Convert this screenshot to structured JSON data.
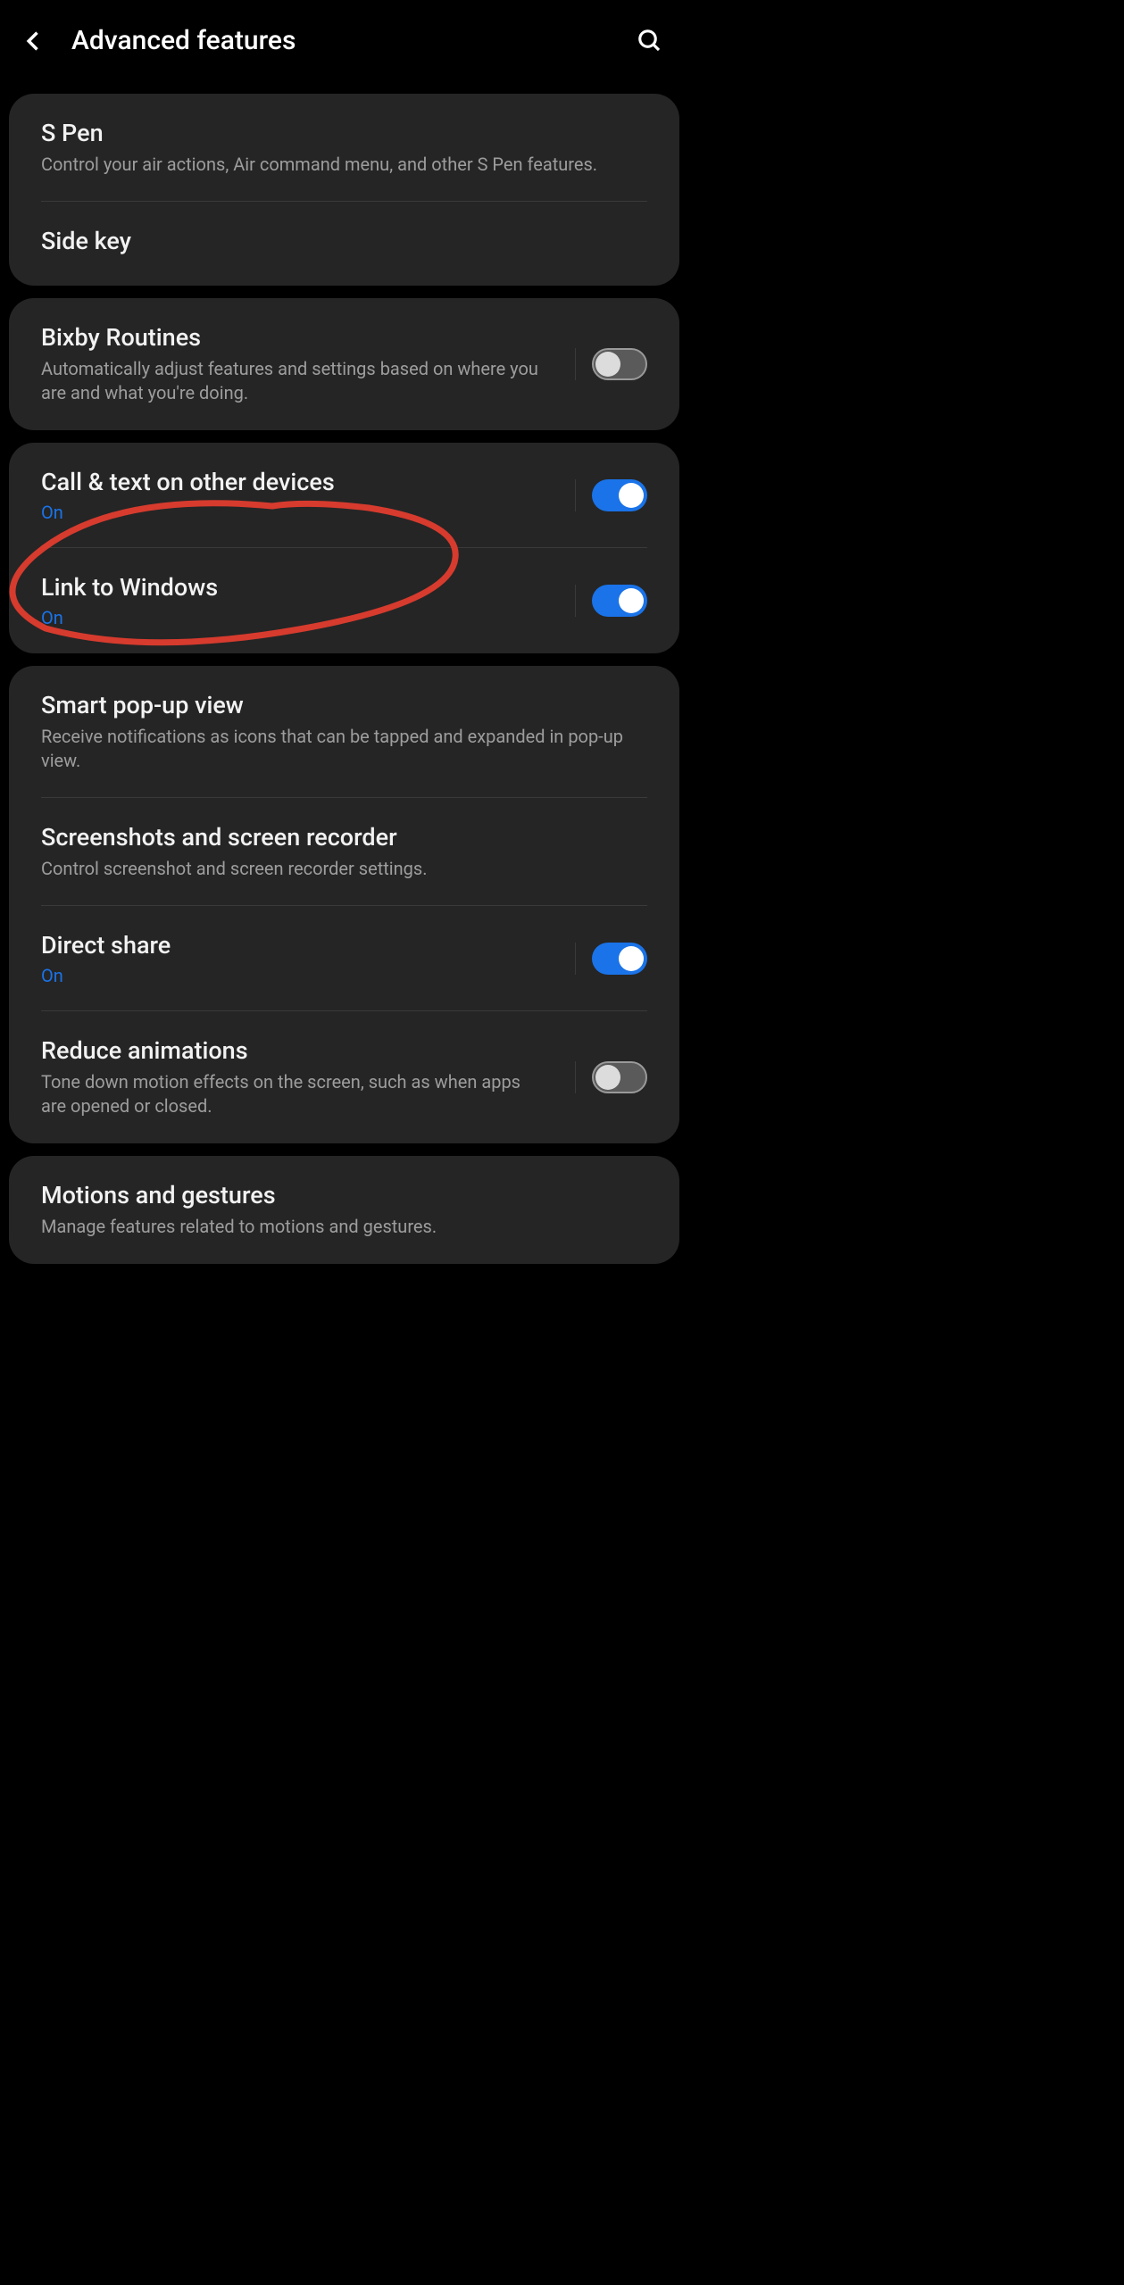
{
  "header": {
    "title": "Advanced features"
  },
  "groups": [
    {
      "id": "g1",
      "items": [
        {
          "id": "spen",
          "title": "S Pen",
          "desc": "Control your air actions, Air command menu, and other S Pen features.",
          "status": null,
          "toggle": null
        },
        {
          "id": "sidekey",
          "title": "Side key",
          "desc": null,
          "status": null,
          "toggle": null
        }
      ]
    },
    {
      "id": "g2",
      "items": [
        {
          "id": "bixby",
          "title": "Bixby Routines",
          "desc": "Automatically adjust features and settings based on where you are and what you're doing.",
          "status": null,
          "toggle": "off"
        }
      ]
    },
    {
      "id": "g3",
      "items": [
        {
          "id": "calltext",
          "title": "Call & text on other devices",
          "desc": null,
          "status": "On",
          "toggle": "on"
        },
        {
          "id": "linkwin",
          "title": "Link to Windows",
          "desc": null,
          "status": "On",
          "toggle": "on"
        }
      ]
    },
    {
      "id": "g4",
      "items": [
        {
          "id": "popup",
          "title": "Smart pop-up view",
          "desc": "Receive notifications as icons that can be tapped and expanded in pop-up view.",
          "status": null,
          "toggle": null
        },
        {
          "id": "screenshot",
          "title": "Screenshots and screen recorder",
          "desc": "Control screenshot and screen recorder settings.",
          "status": null,
          "toggle": null
        },
        {
          "id": "directshare",
          "title": "Direct share",
          "desc": null,
          "status": "On",
          "toggle": "on"
        },
        {
          "id": "reduceanim",
          "title": "Reduce animations",
          "desc": "Tone down motion effects on the screen, such as when apps are opened or closed.",
          "status": null,
          "toggle": "off"
        }
      ]
    },
    {
      "id": "g5",
      "items": [
        {
          "id": "motions",
          "title": "Motions and gestures",
          "desc": "Manage features related to motions and gestures.",
          "status": null,
          "toggle": null
        }
      ]
    }
  ]
}
